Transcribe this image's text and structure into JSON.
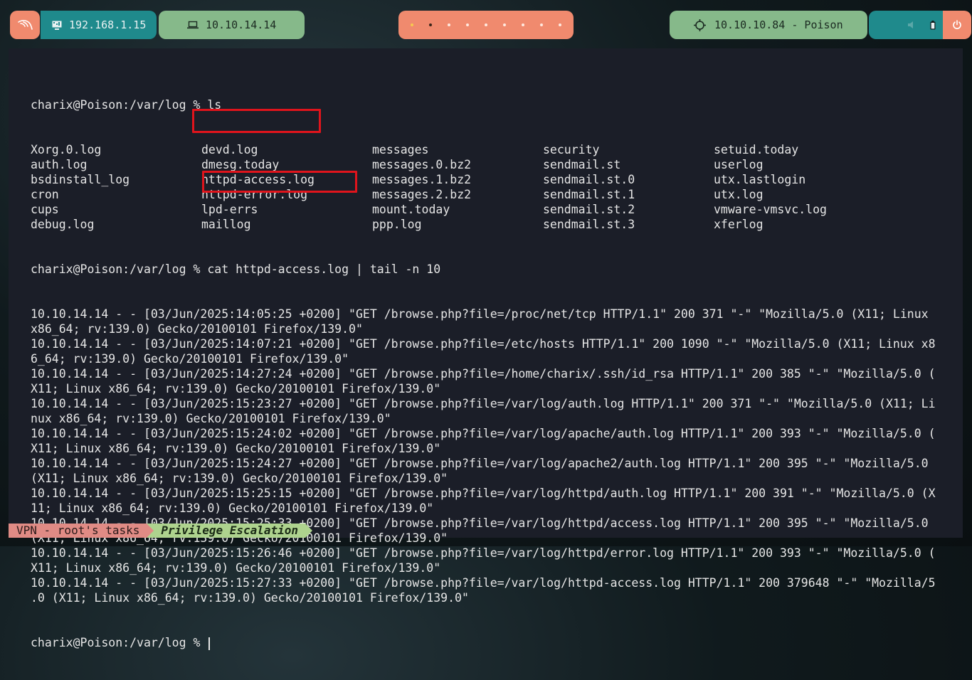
{
  "topbar": {
    "logo_icon": "kali-dragon-icon",
    "local_ip": "192.168.1.15",
    "local_icon": "monitor-icon",
    "vpn_ip": "10.10.14.14",
    "vpn_icon": "laptop-icon",
    "workspaces_count": 9,
    "target": "10.10.10.84 - Poison",
    "target_icon": "crosshair-icon",
    "colors": {
      "orange": "#f08a6e",
      "teal": "#1f8a8c",
      "green": "#86b98a"
    }
  },
  "terminal": {
    "prompt1": "charix@Poison:/var/log % ls",
    "ls_rows": [
      [
        "Xorg.0.log",
        "devd.log",
        "messages",
        "security",
        "setuid.today"
      ],
      [
        "auth.log",
        "dmesg.today",
        "messages.0.bz2",
        "sendmail.st",
        "userlog"
      ],
      [
        "bsdinstall_log",
        "httpd-access.log",
        "messages.1.bz2",
        "sendmail.st.0",
        "utx.lastlogin"
      ],
      [
        "cron",
        "httpd-error.log",
        "messages.2.bz2",
        "sendmail.st.1",
        "utx.log"
      ],
      [
        "cups",
        "lpd-errs",
        "mount.today",
        "sendmail.st.2",
        "vmware-vmsvc.log"
      ],
      [
        "debug.log",
        "maillog",
        "ppp.log",
        "sendmail.st.3",
        "xferlog"
      ]
    ],
    "prompt2": "charix@Poison:/var/log % cat httpd-access.log | tail -n 10",
    "log_lines": [
      "10.10.14.14 - - [03/Jun/2025:14:05:25 +0200] \"GET /browse.php?file=/proc/net/tcp HTTP/1.1\" 200 371 \"-\" \"Mozilla/5.0 (X11; Linux",
      "x86_64; rv:139.0) Gecko/20100101 Firefox/139.0\"",
      "10.10.14.14 - - [03/Jun/2025:14:07:21 +0200] \"GET /browse.php?file=/etc/hosts HTTP/1.1\" 200 1090 \"-\" \"Mozilla/5.0 (X11; Linux x8",
      "6_64; rv:139.0) Gecko/20100101 Firefox/139.0\"",
      "10.10.14.14 - - [03/Jun/2025:14:27:24 +0200] \"GET /browse.php?file=/home/charix/.ssh/id_rsa HTTP/1.1\" 200 385 \"-\" \"Mozilla/5.0 (",
      "X11; Linux x86_64; rv:139.0) Gecko/20100101 Firefox/139.0\"",
      "10.10.14.14 - - [03/Jun/2025:15:23:27 +0200] \"GET /browse.php?file=/var/log/auth.log HTTP/1.1\" 200 371 \"-\" \"Mozilla/5.0 (X11; Li",
      "nux x86_64; rv:139.0) Gecko/20100101 Firefox/139.0\"",
      "10.10.14.14 - - [03/Jun/2025:15:24:02 +0200] \"GET /browse.php?file=/var/log/apache/auth.log HTTP/1.1\" 200 393 \"-\" \"Mozilla/5.0 (",
      "X11; Linux x86_64; rv:139.0) Gecko/20100101 Firefox/139.0\"",
      "10.10.14.14 - - [03/Jun/2025:15:24:27 +0200] \"GET /browse.php?file=/var/log/apache2/auth.log HTTP/1.1\" 200 395 \"-\" \"Mozilla/5.0",
      "(X11; Linux x86_64; rv:139.0) Gecko/20100101 Firefox/139.0\"",
      "10.10.14.14 - - [03/Jun/2025:15:25:15 +0200] \"GET /browse.php?file=/var/log/httpd/auth.log HTTP/1.1\" 200 391 \"-\" \"Mozilla/5.0 (X",
      "11; Linux x86_64; rv:139.0) Gecko/20100101 Firefox/139.0\"",
      "10.10.14.14 - - [03/Jun/2025:15:25:33 +0200] \"GET /browse.php?file=/var/log/httpd/access.log HTTP/1.1\" 200 395 \"-\" \"Mozilla/5.0",
      "(X11; Linux x86_64; rv:139.0) Gecko/20100101 Firefox/139.0\"",
      "10.10.14.14 - - [03/Jun/2025:15:26:46 +0200] \"GET /browse.php?file=/var/log/httpd/error.log HTTP/1.1\" 200 393 \"-\" \"Mozilla/5.0 (",
      "X11; Linux x86_64; rv:139.0) Gecko/20100101 Firefox/139.0\"",
      "10.10.14.14 - - [03/Jun/2025:15:27:33 +0200] \"GET /browse.php?file=/var/log/httpd-access.log HTTP/1.1\" 200 379648 \"-\" \"Mozilla/5",
      ".0 (X11; Linux x86_64; rv:139.0) Gecko/20100101 Firefox/139.0\""
    ],
    "prompt3": "charix@Poison:/var/log % ",
    "highlight_color": "#e0141c"
  },
  "statusbar": {
    "session": "VPN - root's tasks",
    "window": "Privilege Escalation"
  }
}
